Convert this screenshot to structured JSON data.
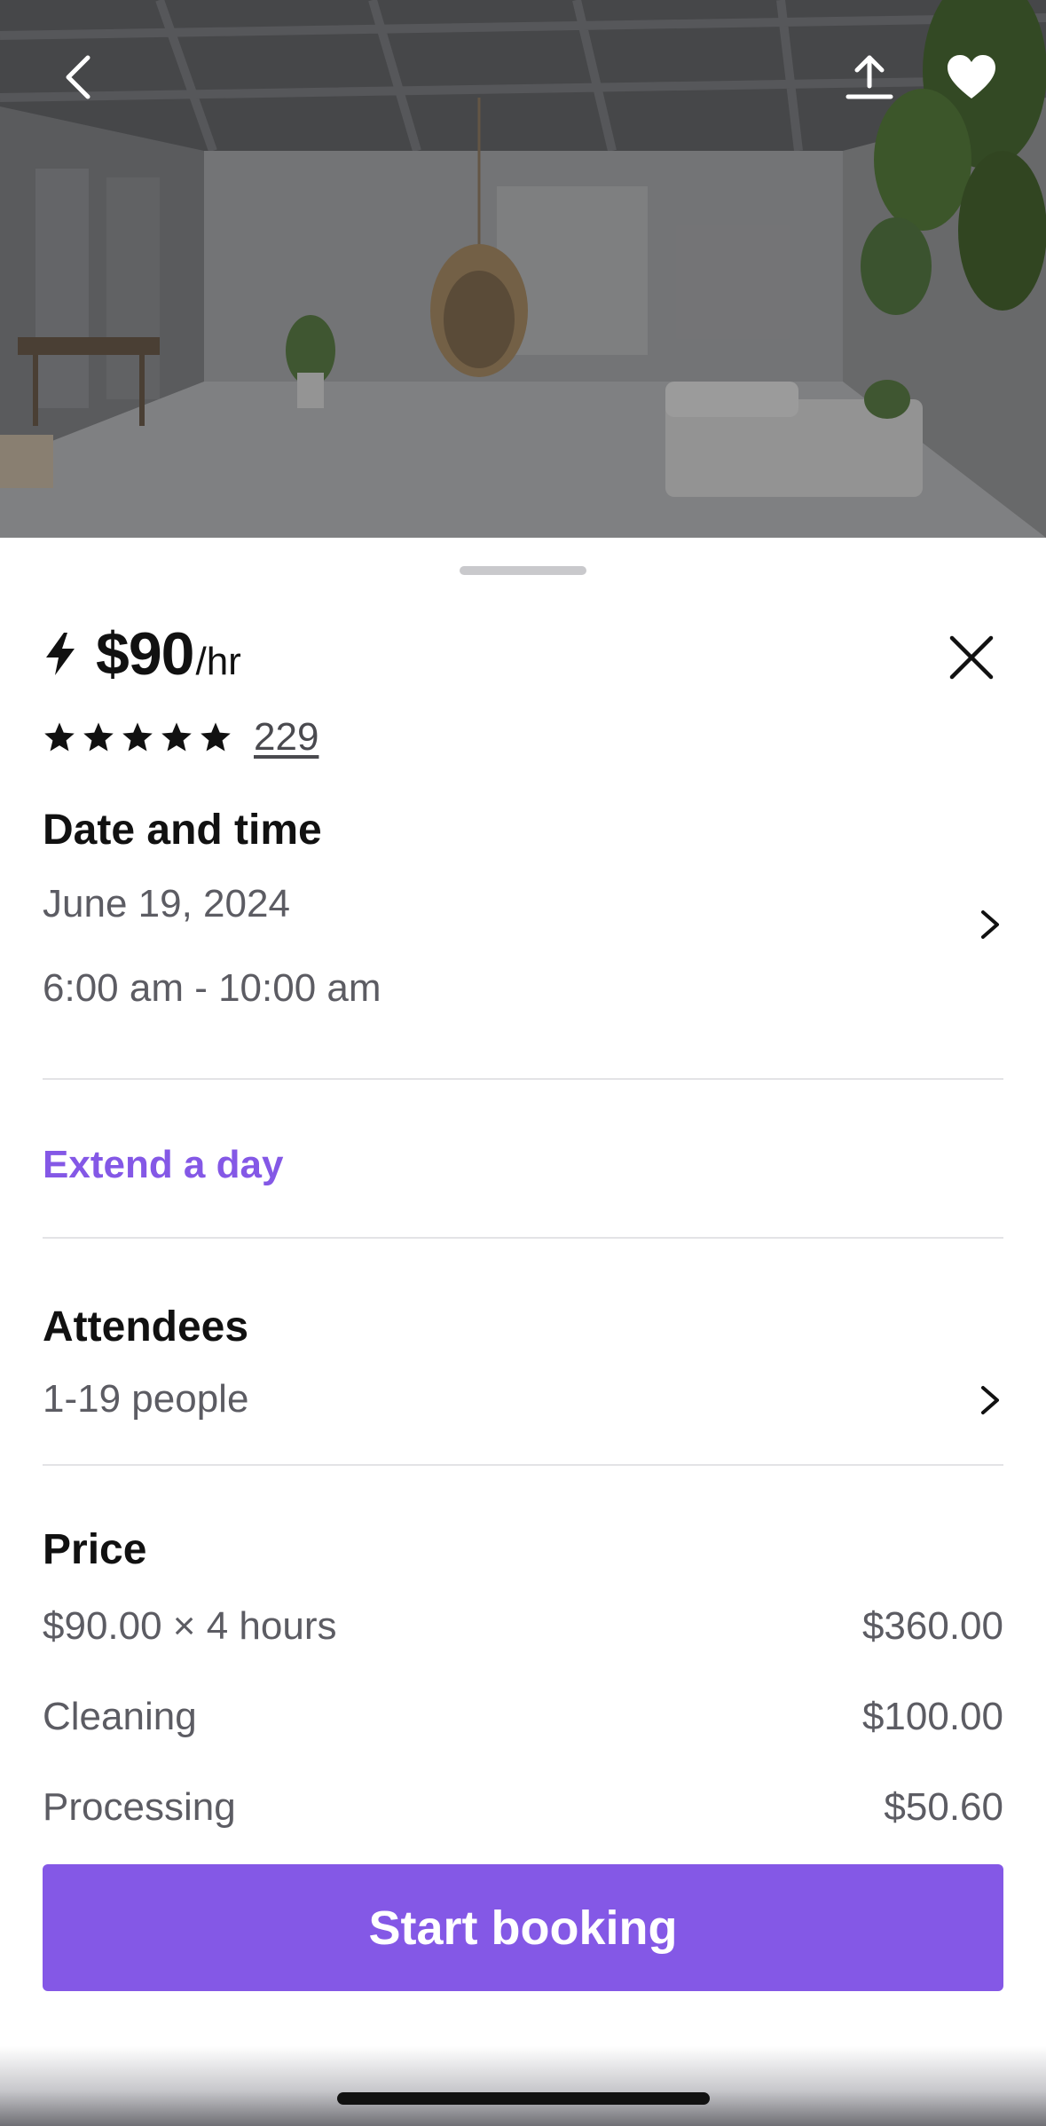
{
  "hero": {
    "image_alt": "",
    "icons": {
      "back": "chevron-left-icon",
      "share": "share-upload-icon",
      "favorite": "heart-icon"
    },
    "favorite_color": "#ffffff"
  },
  "listing": {
    "instant_icon": "lightning-bolt-icon",
    "price": "$90",
    "price_unit": "/hr",
    "rating_stars": 5,
    "review_count": "229"
  },
  "date_time": {
    "title": "Date and time",
    "date": "June 19, 2024",
    "time": "6:00 am - 10:00 am"
  },
  "extend": {
    "label": "Extend a day"
  },
  "attendees": {
    "title": "Attendees",
    "value": "1-19 people"
  },
  "price": {
    "title": "Price",
    "items": [
      {
        "label": "$90.00 × 4 hours",
        "amount": "$360.00"
      },
      {
        "label": "Cleaning",
        "amount": "$100.00"
      },
      {
        "label": "Processing",
        "amount": "$50.60"
      }
    ]
  },
  "cta": {
    "label": "Start booking"
  },
  "colors": {
    "accent": "#8458e6",
    "text": "#111111",
    "muted": "#5c5c63",
    "divider": "#e3e3e6"
  }
}
